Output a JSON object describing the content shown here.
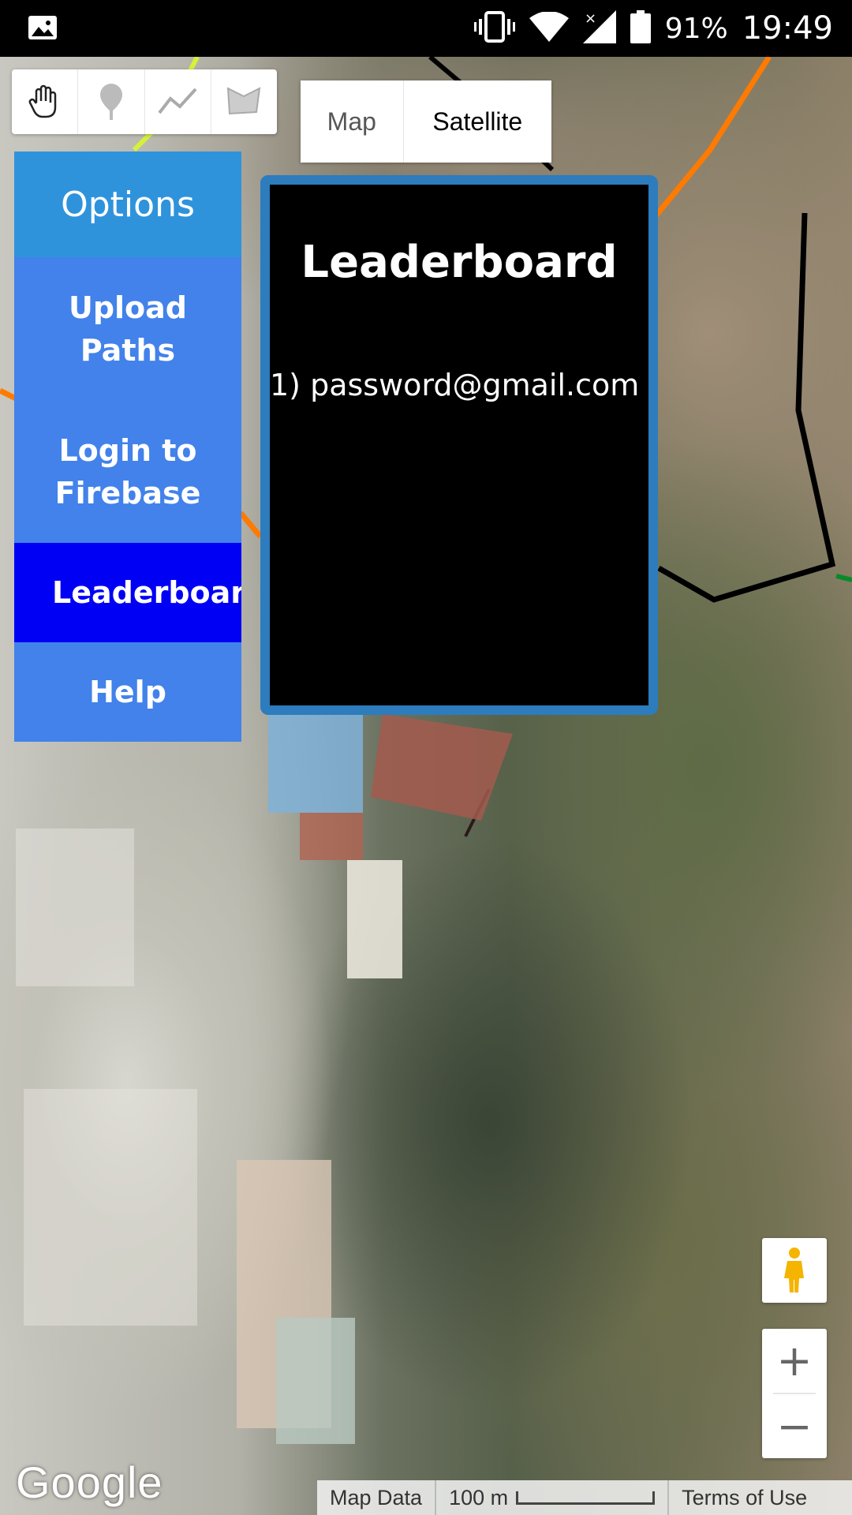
{
  "status_bar": {
    "battery_percent": "91%",
    "time": "19:49",
    "icons": [
      "gallery-icon",
      "vibrate-icon",
      "wifi-icon",
      "cell-signal-icon",
      "battery-icon"
    ]
  },
  "draw_toolbar": {
    "tools": [
      "hand-icon",
      "marker-icon",
      "polyline-icon",
      "polygon-icon"
    ]
  },
  "map_type": {
    "map_label": "Map",
    "satellite_label": "Satellite",
    "selected": "Satellite"
  },
  "options_menu": {
    "header": "Options",
    "items": [
      {
        "label": "Upload Paths"
      },
      {
        "label": "Login to Firebase"
      },
      {
        "label": "Leaderboard",
        "active": true
      },
      {
        "label": "Help"
      }
    ],
    "colors": {
      "header": "#2f93dc",
      "item": "#4282ea",
      "active": "#0000f5"
    }
  },
  "leaderboard": {
    "title": "Leaderboard",
    "entries": [
      "1) password@gmail.com"
    ]
  },
  "map_controls": {
    "zoom_in": "+",
    "zoom_out": "−"
  },
  "footer": {
    "logo": "Google",
    "map_data": "Map Data",
    "scale": "100 m",
    "terms": "Terms of Use"
  }
}
